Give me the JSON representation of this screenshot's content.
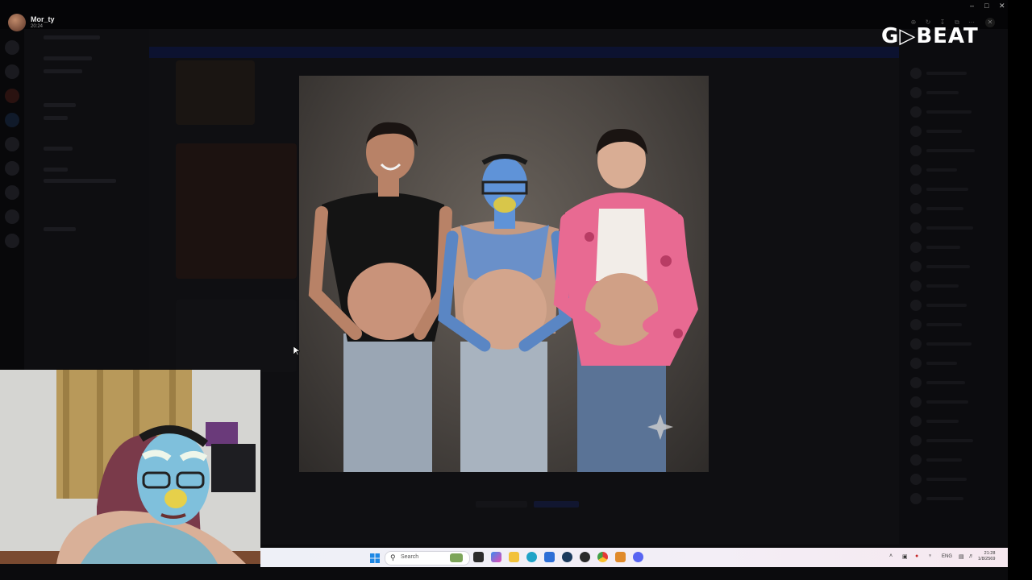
{
  "stream": {
    "user_name": "Mor_ty",
    "user_time": "20:24",
    "brand": "G▷BEAT"
  },
  "window": {
    "title_text": "",
    "controls": [
      "minimize-icon",
      "maximize-icon",
      "close-icon"
    ]
  },
  "viewer_toolbar": [
    "zoom-in-icon",
    "rotate-icon",
    "download-icon",
    "open-external-icon",
    "more-icon",
    "close-icon"
  ],
  "photo": {
    "subject": "three-men-pregnant-belly-photo"
  },
  "taskbar": {
    "search_placeholder": "Search",
    "tray": {
      "language": "ENG",
      "time": "21:28",
      "date": "1/8/2569"
    }
  },
  "colors": {
    "taskbar_bg": "#eef0f7",
    "app_bg": "#0b0b0d",
    "brand_color": "#ffffff"
  }
}
